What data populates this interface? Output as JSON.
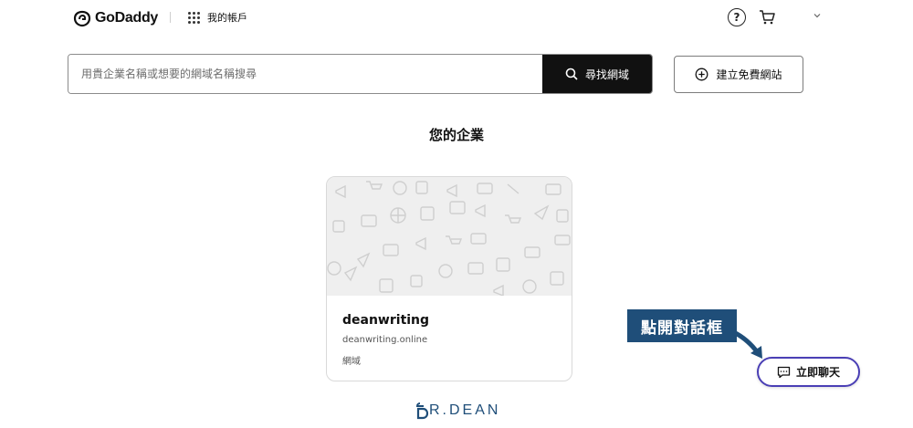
{
  "header": {
    "logo_text": "GoDaddy",
    "apps_label": "我的帳戶",
    "help_glyph": "?"
  },
  "search": {
    "placeholder": "用貴企業名稱或想要的網域名稱搜尋",
    "button_label": "尋找網域"
  },
  "free_site_button": {
    "label": "建立免費網站"
  },
  "section": {
    "title": "您的企業"
  },
  "business_card": {
    "name": "deanwriting",
    "domain": "deanwriting.online",
    "type": "網域"
  },
  "annotation": {
    "text": "點開對話框"
  },
  "chat": {
    "label": "立即聊天"
  },
  "watermark": {
    "text": "R.DEAN"
  },
  "colors": {
    "search_button": "#111111",
    "annotation_bg": "#1f4e79",
    "chat_border": "#4a3fb5",
    "banner_bg": "#efefef"
  }
}
